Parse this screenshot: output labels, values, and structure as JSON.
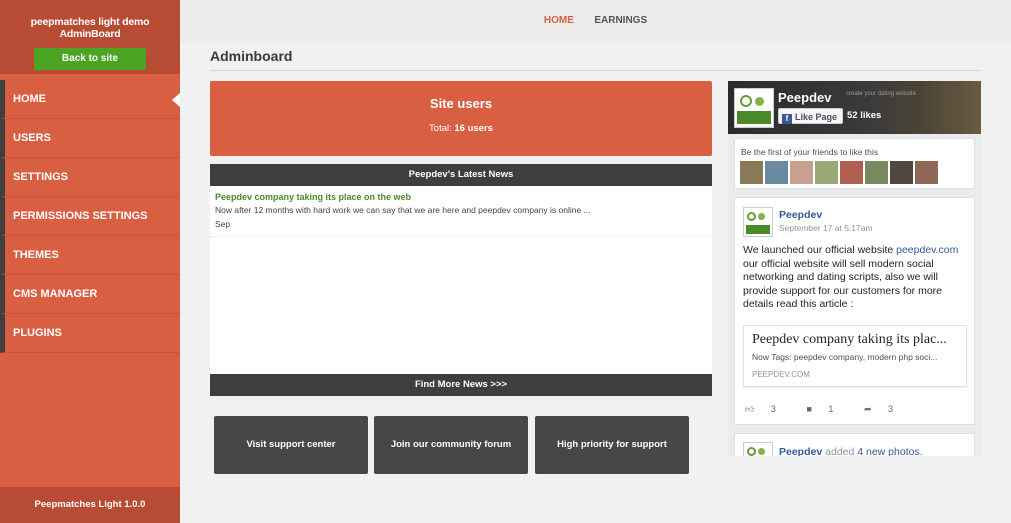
{
  "sidebar": {
    "title": "peepmatches light demo AdminBoard",
    "back_label": "Back to site",
    "items": [
      {
        "label": "HOME"
      },
      {
        "label": "USERS"
      },
      {
        "label": "SETTINGS"
      },
      {
        "label": "PERMISSIONS SETTINGS"
      },
      {
        "label": "THEMES"
      },
      {
        "label": "CMS MANAGER"
      },
      {
        "label": "PLUGINS"
      }
    ],
    "footer_name": "Peepmatches Light",
    "footer_version": "1.0.0"
  },
  "topnav": {
    "home": "HOME",
    "earnings": "EARNINGS"
  },
  "page_title": "Adminboard",
  "site_users": {
    "title": "Site users",
    "total_label": "Total:",
    "total_count": "16 users"
  },
  "news": {
    "header": "Peepdev's Latest News",
    "item_title": "Peepdev company taking its place on the web",
    "item_text": "Now  after 12 months with hard work we can say that we are here and peepdev company is online ...",
    "item_date": "Sep",
    "footer": "Find More News >>>"
  },
  "actions": {
    "support": "Visit support center",
    "forum": "Join our community forum",
    "priority": "High priority for support"
  },
  "facebook": {
    "page_name": "Peepdev",
    "tagline": "create your dating website",
    "like_button": "Like Page",
    "likes": "52 likes",
    "friends_text": "Be the first of your friends to like this",
    "post": {
      "author": "Peepdev",
      "date": "September 17 at 5:17am",
      "body_prefix": "We launched our official website ",
      "body_link": "peepdev.com",
      "body_rest": " our official website will sell modern social networking and dating scripts, also we will provide support for our customers for more details read this article :",
      "card_title": "Peepdev company taking its plac...",
      "card_desc": "Now Tags: peepdev company, modern php soci...",
      "card_domain": "PEEPDEV.COM",
      "likes": "3",
      "comments": "1",
      "shares": "3"
    },
    "post2": {
      "author": "Peepdev",
      "verb": "added",
      "link": "4 new photos."
    }
  },
  "colors": {
    "accent": "#d95f43",
    "sidebar_dark": "#b84b33",
    "back_button": "#4ba523",
    "dark_bar": "#3e3e3e",
    "fb_link": "#365899"
  }
}
